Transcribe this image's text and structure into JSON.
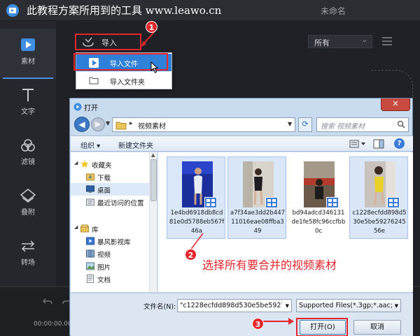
{
  "app": {
    "banner": "此教程方案所用到的工具 www.leawo.cn",
    "doc_title": "未命名",
    "colors": {
      "accent": "#e3262c",
      "selection": "#2f80d8",
      "dark_bg": "#23252b"
    }
  },
  "sidebar": {
    "items": [
      {
        "label": "素材",
        "icon": "media-icon"
      },
      {
        "label": "文字",
        "icon": "text-icon"
      },
      {
        "label": "滤镜",
        "icon": "filter-icon"
      },
      {
        "label": "叠附",
        "icon": "overlay-icon"
      },
      {
        "label": "转场",
        "icon": "transition-icon"
      }
    ]
  },
  "main": {
    "import_label": "导入",
    "filter_value": "所有"
  },
  "dropdown": {
    "items": [
      "导入文件",
      "导入文件夹"
    ]
  },
  "timeline": {
    "time": "00:00:00.00"
  },
  "annotations": {
    "step1": "1",
    "step2": "2",
    "step3": "3",
    "step2_text": "选择所有要合并的视频素材"
  },
  "dialog": {
    "title": "打开",
    "close_label": "✕",
    "address": "视频素材",
    "search_placeholder": "搜索 视频素材",
    "toolbar": {
      "organize": "组织 ▾",
      "new_folder": "新建文件夹"
    },
    "nav": {
      "favorites": "收藏夹",
      "downloads": "下载",
      "desktop": "桌面",
      "recent": "最近访问的位置",
      "libraries": "库",
      "storm": "暴风影视库",
      "videos": "视频",
      "pictures": "图片",
      "documents": "文档"
    },
    "files": [
      "1e4bd6918db8cd81e0d5788eb567f46a",
      "a7f34ae3dd2b44711016eae08ffba349",
      "bd94adcd346131de1fe58fc96ccfbb0c",
      "c1228ecfdd898d530e5be5927624556e"
    ],
    "filename_label": "文件名(N):",
    "filename_value": "\"c1228ecfdd898d530e5be5927",
    "filetype_value": "Supported Files(*.3gp;*.aac;*",
    "open_label": "打开(O)",
    "cancel_label": "取消"
  }
}
